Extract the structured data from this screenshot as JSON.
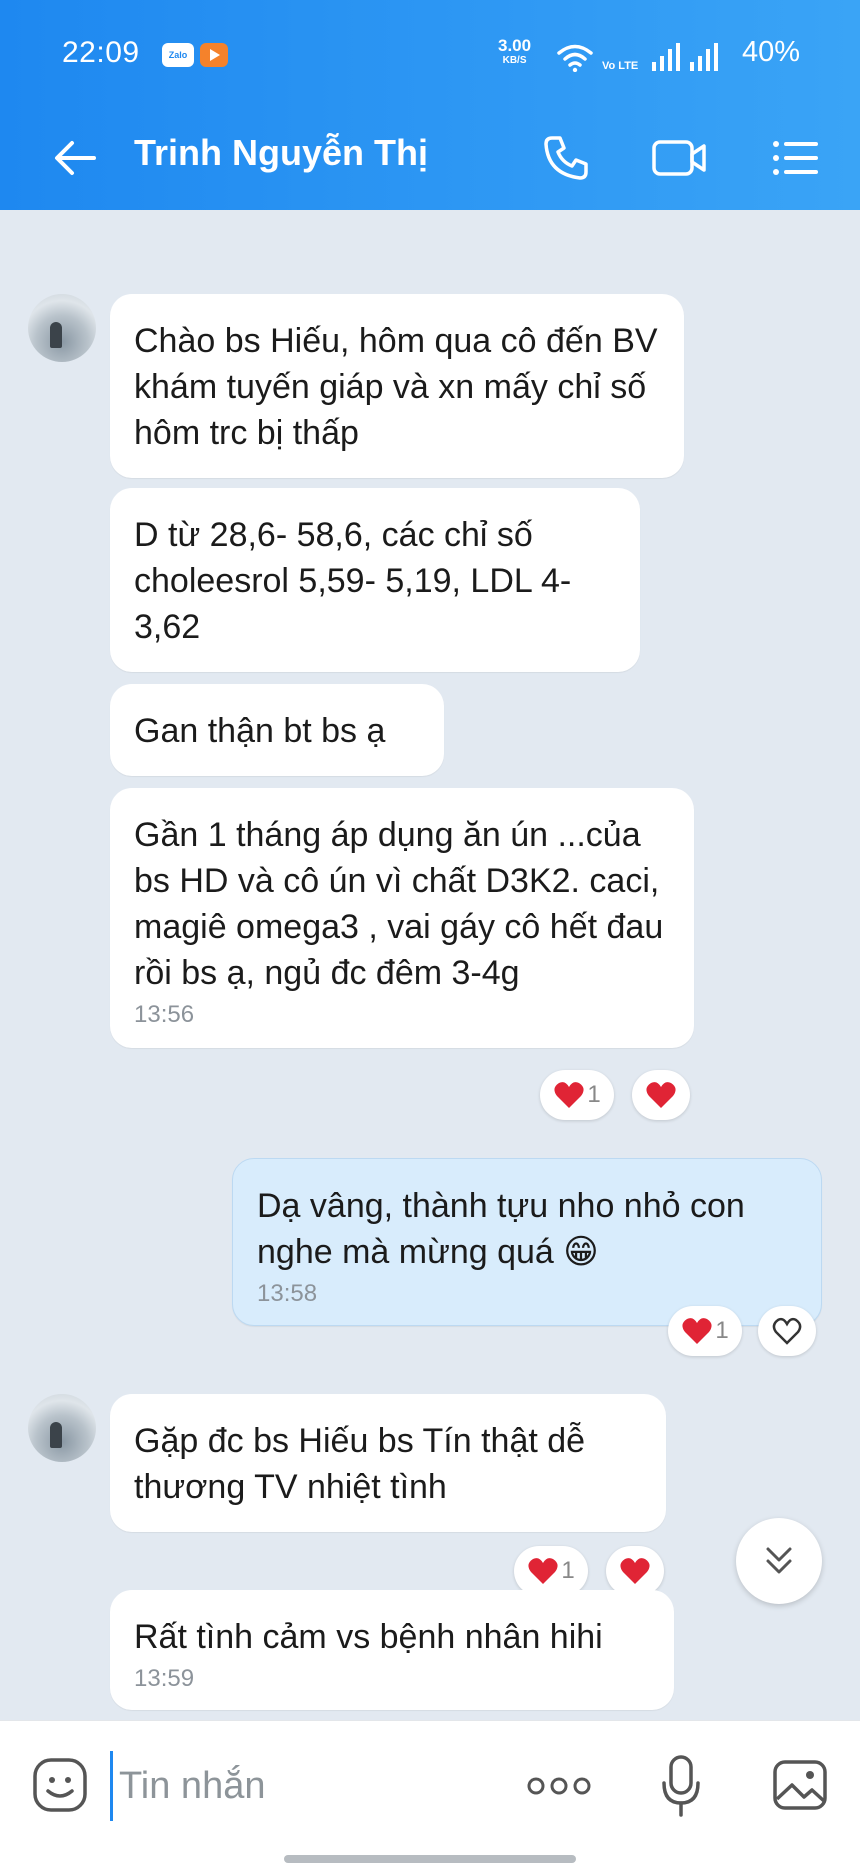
{
  "status_bar": {
    "time": "22:09",
    "app_badge": "Zalo",
    "net_speed": "3.00",
    "net_unit": "KB/S",
    "volte": "Vo LTE",
    "battery": "40%"
  },
  "app_bar": {
    "contact_name": "Trinh Nguyễn Thị"
  },
  "messages": [
    {
      "direction": "in",
      "text": "Chào bs Hiếu, hôm qua cô đến BV khám tuyến giáp và xn mấy chỉ số hôm trc bị thấp",
      "time": ""
    },
    {
      "direction": "in",
      "text": "D từ 28,6- 58,6, các chỉ số choleesrol 5,59- 5,19, LDL 4- 3,62",
      "time": ""
    },
    {
      "direction": "in",
      "text": "Gan thận bt  bs ạ",
      "time": ""
    },
    {
      "direction": "in",
      "text": "Gần 1 tháng áp dụng ăn ún ...của bs HD và cô ún vì chất D3K2. caci, magiê omega3 , vai gáy cô hết đau rồi bs ạ, ngủ đc đêm 3-4g",
      "time": "13:56",
      "reaction_count": "1"
    },
    {
      "direction": "out",
      "text": "Dạ vâng, thành tựu nho nhỏ con nghe mà mừng quá 😁",
      "time": "13:58",
      "reaction_count": "1"
    },
    {
      "direction": "in",
      "text": "Gặp đc bs Hiếu bs Tín thật dễ thương TV nhiệt tình",
      "time": "",
      "reaction_count": "1"
    },
    {
      "direction": "in",
      "text": "Rất tình cảm vs bệnh nhân hihi",
      "time": "13:59"
    }
  ],
  "input": {
    "placeholder": "Tin nhắn"
  },
  "colors": {
    "header_start": "#1e88f0",
    "header_end": "#3aa4f6",
    "chat_bg": "#e2e9f1",
    "outgoing_bubble": "#d8ecfc",
    "heart": "#e02435"
  },
  "icons": [
    "back-arrow-icon",
    "phone-icon",
    "video-camera-icon",
    "menu-list-icon",
    "heart-icon",
    "heart-outline-icon",
    "double-chevron-down-icon",
    "emoji-icon",
    "more-dots-icon",
    "microphone-icon",
    "image-icon"
  ]
}
